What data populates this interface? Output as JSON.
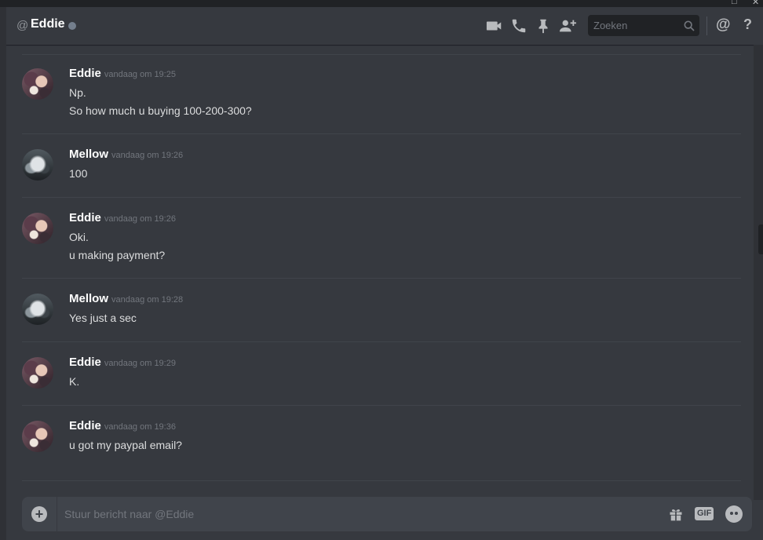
{
  "header": {
    "at_symbol": "@",
    "title": "Eddie",
    "status_color": "#747f8d",
    "icons": [
      "video-call-icon",
      "voice-call-icon",
      "pinned-messages-icon",
      "add-friend-icon"
    ],
    "search": {
      "placeholder": "Zoeken"
    },
    "mentions_label": "@",
    "help_label": "?"
  },
  "messages": [
    {
      "author": "Eddie",
      "timestamp": "vandaag om 19:25",
      "lines": [
        "Np.",
        "So how much u buying 100-200-300?"
      ]
    },
    {
      "author": "Mellow",
      "timestamp": "vandaag om 19:26",
      "lines": [
        "100"
      ]
    },
    {
      "author": "Eddie",
      "timestamp": "vandaag om 19:26",
      "lines": [
        "Oki.",
        "u making payment?"
      ]
    },
    {
      "author": "Mellow",
      "timestamp": "vandaag om 19:28",
      "lines": [
        "Yes just a sec"
      ]
    },
    {
      "author": "Eddie",
      "timestamp": "vandaag om 19:29",
      "lines": [
        "K."
      ]
    },
    {
      "author": "Eddie",
      "timestamp": "vandaag om 19:36",
      "lines": [
        "u got my paypal email?"
      ]
    }
  ],
  "composer": {
    "attach_label": "+",
    "placeholder": "Stuur bericht naar @Eddie",
    "gif_label": "GIF"
  },
  "colors": {
    "background": "#36393f",
    "header_text": "#ffffff",
    "timestamp": "#72767d",
    "message_text": "#dcddde",
    "input_bg": "#40444b"
  }
}
